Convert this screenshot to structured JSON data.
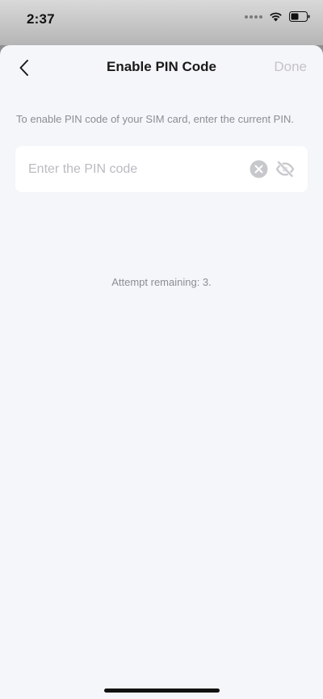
{
  "status_bar": {
    "time": "2:37",
    "icons": [
      "signal-dots-icon",
      "wifi-icon",
      "battery-icon"
    ]
  },
  "nav": {
    "back_icon": "chevron-left-icon",
    "title": "Enable PIN Code",
    "done_label": "Done"
  },
  "form": {
    "instruction": "To enable PIN code of your SIM card, enter the current PIN.",
    "pin_input": {
      "value": "",
      "placeholder": "Enter the PIN code"
    },
    "clear_icon": "clear-circle-icon",
    "visibility_icon": "eye-off-icon"
  },
  "attempts_text": "Attempt remaining: 3.",
  "colors": {
    "background": "#f5f6fa",
    "card": "#ffffff",
    "title": "#1a1a1a",
    "muted_text": "#8a8d94",
    "disabled": "#c4c4c8",
    "icon_gray": "#c7c8cc"
  }
}
